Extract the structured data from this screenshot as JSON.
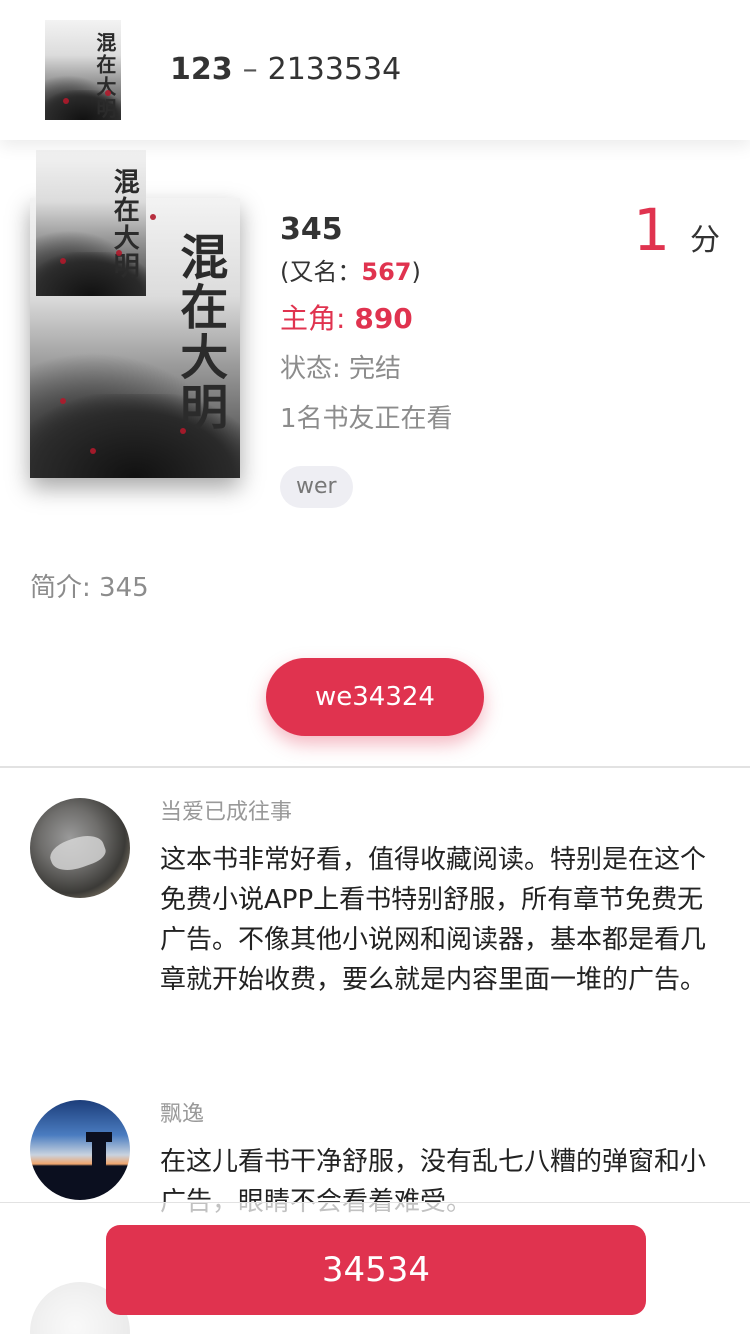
{
  "header": {
    "title_a": "123",
    "dash": "–",
    "title_b": "2133534"
  },
  "book": {
    "cover_text": "混在大明",
    "title": "345",
    "alias_prefix": "(又名：",
    "alias_value": "567",
    "alias_suffix": ")",
    "lead_label": "主角: ",
    "lead_value": "890",
    "status": "状态: 完结",
    "readers": "1名书友正在看",
    "tag": "wer",
    "score_value": "1",
    "score_unit": "分",
    "intro": "简介: 345"
  },
  "read_button": "we34324",
  "comments": [
    {
      "name": "当爱已成往事",
      "text": "这本书非常好看，值得收藏阅读。特别是在这个免费小说APP上看书特别舒服，所有章节免费无广告。不像其他小说网和阅读器，基本都是看几章就开始收费，要么就是内容里面一堆的广告。"
    },
    {
      "name": "飘逸",
      "text": "在这儿看书干净舒服，没有乱七八糟的弹窗和小广告，眼睛不会看着难受。"
    },
    {
      "name": "",
      "text": ""
    }
  ],
  "bottom_button": "34534",
  "colors": {
    "accent": "#e0334f",
    "muted": "#8c8c8c"
  }
}
